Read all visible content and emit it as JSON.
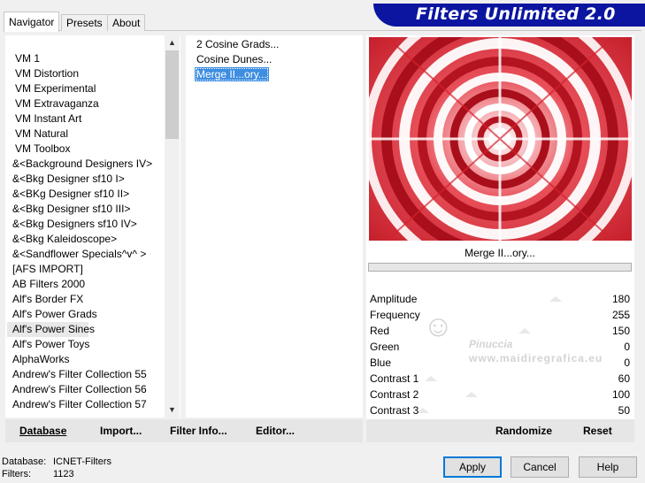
{
  "app": {
    "banner_title": "Filters Unlimited 2.0"
  },
  "tabs": [
    {
      "label": "Navigator",
      "active": true
    },
    {
      "label": "Presets",
      "active": false
    },
    {
      "label": "About",
      "active": false
    }
  ],
  "categories": {
    "items": [
      "VM 1",
      "VM Distortion",
      "VM Experimental",
      "VM Extravaganza",
      "VM Instant Art",
      "VM Natural",
      "VM Toolbox",
      "&<Background Designers IV>",
      "&<Bkg Designer sf10 I>",
      "&<BKg Designer sf10 II>",
      "&<Bkg Designer sf10 III>",
      "&<Bkg Designers sf10 IV>",
      "&<Bkg Kaleidoscope>",
      "&<Sandflower Specials^v^ >",
      "[AFS IMPORT]",
      "AB Filters 2000",
      "Alf's Border FX",
      "Alf's Power Grads",
      "Alf's Power Sines",
      "Alf's Power Toys",
      "AlphaWorks",
      "Andrew's Filter Collection 55",
      "Andrew's Filter Collection 56",
      "Andrew's Filter Collection 57"
    ],
    "selected": "Alf's Power Sines"
  },
  "filters": {
    "items": [
      "2 Cosine Grads...",
      "Cosine Dunes...",
      "Merge II...ory..."
    ],
    "selected": "Merge II...ory..."
  },
  "preview": {
    "caption": "Merge II...ory...",
    "accent_color": "#d4222e"
  },
  "params": [
    {
      "label": "Amplitude",
      "value": "180"
    },
    {
      "label": "Frequency",
      "value": "255"
    },
    {
      "label": "Red",
      "value": "150"
    },
    {
      "label": "Green",
      "value": "0"
    },
    {
      "label": "Blue",
      "value": "0"
    },
    {
      "label": "Contrast 1",
      "value": "60"
    },
    {
      "label": "Contrast 2",
      "value": "100"
    },
    {
      "label": "Contrast 3",
      "value": "50"
    }
  ],
  "toolbar": {
    "database": "Database",
    "import": "Import...",
    "filter_info": "Filter Info...",
    "editor": "Editor...",
    "randomize": "Randomize",
    "reset": "Reset"
  },
  "buttons": {
    "apply": "Apply",
    "cancel": "Cancel",
    "help": "Help"
  },
  "status": {
    "database_label": "Database:",
    "database_value": "ICNET-Filters",
    "filters_label": "Filters:",
    "filters_value": "1123"
  },
  "watermark": {
    "name": "Pinuccia",
    "url": "www.maidiregrafica.eu"
  },
  "icons": {
    "scroll_up": "▲",
    "scroll_down": "▼"
  }
}
